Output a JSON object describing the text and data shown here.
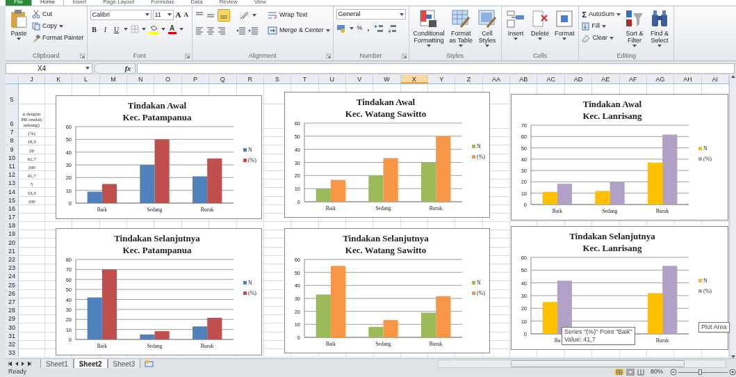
{
  "ribbon": {
    "tabs": [
      {
        "label": "File",
        "selected": false
      },
      {
        "label": "Home",
        "selected": true
      },
      {
        "label": "Insert",
        "selected": false
      },
      {
        "label": "Page Layout",
        "selected": false
      },
      {
        "label": "Formulas",
        "selected": false
      },
      {
        "label": "Data",
        "selected": false
      },
      {
        "label": "Review",
        "selected": false
      },
      {
        "label": "View",
        "selected": false
      }
    ],
    "clipboard": {
      "label": "Clipboard",
      "paste": "Paste",
      "cut": "Cut",
      "copy": "Copy",
      "format_painter": "Format Painter"
    },
    "font": {
      "label": "Font",
      "font_name": "Calibri",
      "font_size": "11",
      "grow": "A",
      "shrink": "A",
      "bold": "B",
      "italic": "I",
      "underline": "U",
      "font_color": "A"
    },
    "alignment": {
      "label": "Alignment",
      "bottom_align_selected": true,
      "wrap_text": "Wrap Text",
      "merge_center": "Merge & Center"
    },
    "number": {
      "label": "Number",
      "format": "General",
      "percent": "%",
      "comma": ","
    },
    "styles": {
      "label": "Styles",
      "buttons": [
        "Conditional\nFormatting",
        "Format\nas Table",
        "Cell\nStyles"
      ]
    },
    "cells": {
      "label": "Cells",
      "buttons": [
        "Insert",
        "Delete",
        "Format"
      ]
    },
    "editing": {
      "label": "Editing",
      "sigma": "Σ",
      "autosum": "AutoSum",
      "fill": "Fill",
      "clear": "Clear",
      "sort_filter": "Sort &\nFilter",
      "find_select": "Find &\nSelect"
    }
  },
  "formula_bar": {
    "name_box": "X4",
    "function_label": "fx"
  },
  "columns": [
    {
      "label": "J",
      "selected": false
    },
    {
      "label": "K",
      "selected": false
    },
    {
      "label": "L",
      "selected": false
    },
    {
      "label": "M",
      "selected": false
    },
    {
      "label": "N",
      "selected": false
    },
    {
      "label": "O",
      "selected": false
    },
    {
      "label": "P",
      "selected": false
    },
    {
      "label": "Q",
      "selected": false
    },
    {
      "label": "R",
      "selected": false
    },
    {
      "label": "S",
      "selected": false
    },
    {
      "label": "T",
      "selected": false
    },
    {
      "label": "U",
      "selected": false
    },
    {
      "label": "V",
      "selected": false
    },
    {
      "label": "W",
      "selected": false
    },
    {
      "label": "X",
      "selected": true
    },
    {
      "label": "Y",
      "selected": false
    },
    {
      "label": "Z",
      "selected": false
    },
    {
      "label": "AA",
      "selected": false
    },
    {
      "label": "AB",
      "selected": false
    },
    {
      "label": "AC",
      "selected": false
    },
    {
      "label": "AD",
      "selected": false
    },
    {
      "label": "AE",
      "selected": false
    },
    {
      "label": "AF",
      "selected": false
    },
    {
      "label": "AG",
      "selected": false
    },
    {
      "label": "AH",
      "selected": false
    },
    {
      "label": "AI",
      "selected": false
    }
  ],
  "rows": [
    {
      "label": "5"
    },
    {
      "label": "6",
      "j": "n dengan\nPR rendah\nnrisang)"
    },
    {
      "label": "7",
      "j": "(%)"
    },
    {
      "label": "8",
      "j": "18,3"
    },
    {
      "label": "9",
      "j": "20"
    },
    {
      "label": "10",
      "j": "61,7"
    },
    {
      "label": "11",
      "j": "100"
    },
    {
      "label": "12",
      "j": "41,7"
    },
    {
      "label": "13",
      "j": "5"
    },
    {
      "label": "14",
      "j": "53,3"
    },
    {
      "label": "15",
      "j": "100"
    },
    {
      "label": "16"
    },
    {
      "label": "17"
    },
    {
      "label": "18"
    },
    {
      "label": "19"
    },
    {
      "label": "20"
    },
    {
      "label": "21"
    },
    {
      "label": "22"
    },
    {
      "label": "23"
    },
    {
      "label": "24"
    },
    {
      "label": "25"
    },
    {
      "label": "26"
    },
    {
      "label": "27"
    },
    {
      "label": "28"
    },
    {
      "label": "29"
    },
    {
      "label": "30"
    },
    {
      "label": "31"
    },
    {
      "label": "32"
    },
    {
      "label": "33"
    }
  ],
  "charts": [
    {
      "chart_data": {
        "type": "bar",
        "title": "Tindakan Awal\nKec. Patampanua",
        "categories": [
          "Baik",
          "Sedang",
          "Buruk"
        ],
        "series": [
          {
            "name": "N",
            "color": "#4f81bd",
            "values": [
              9,
              30,
              21
            ]
          },
          {
            "name": "(%)",
            "color": "#c0504d",
            "values": [
              15,
              50,
              35
            ]
          }
        ],
        "grid": true,
        "legend": "right",
        "ylim": [
          0,
          60
        ],
        "yticks": [
          0,
          10,
          20,
          30,
          40,
          50,
          60
        ]
      }
    },
    {
      "chart_data": {
        "type": "bar",
        "title": "Tindakan Awal\nKec. Watang Sawitto",
        "categories": [
          "Baik",
          "Sedang",
          "Buruk"
        ],
        "series": [
          {
            "name": "N",
            "color": "#9bbb59",
            "values": [
              10,
              20,
              30
            ]
          },
          {
            "name": "(%)",
            "color": "#f79646",
            "values": [
              16.7,
              33.3,
              50
            ]
          }
        ],
        "grid": true,
        "legend": "right",
        "ylim": [
          0,
          60
        ],
        "yticks": [
          0,
          10,
          20,
          30,
          40,
          50,
          60
        ]
      }
    },
    {
      "chart_data": {
        "type": "bar",
        "title": "Tindakan Awal\nKec. Lanrisang",
        "categories": [
          "Baik",
          "Sedang",
          "Buruk"
        ],
        "series": [
          {
            "name": "N",
            "color": "#ffc000",
            "values": [
              11,
              12,
              37
            ]
          },
          {
            "name": "(%)",
            "color": "#b2a1c7",
            "values": [
              18.3,
              20,
              61.7
            ]
          }
        ],
        "grid": true,
        "legend": "right",
        "ylim": [
          0,
          70
        ],
        "yticks": [
          0,
          10,
          20,
          30,
          40,
          50,
          60,
          70
        ]
      }
    },
    {
      "chart_data": {
        "type": "bar",
        "title": "Tindakan Selanjutnya\nKec. Patampanua",
        "categories": [
          "Baik",
          "Sedang",
          "Buruk"
        ],
        "series": [
          {
            "name": "N",
            "color": "#4f81bd",
            "values": [
              42,
              5,
              13
            ]
          },
          {
            "name": "(%)",
            "color": "#c0504d",
            "values": [
              70,
              8.3,
              21.7
            ]
          }
        ],
        "grid": true,
        "legend": "right",
        "ylim": [
          0,
          80
        ],
        "yticks": [
          0,
          10,
          20,
          30,
          40,
          50,
          60,
          70,
          80
        ]
      }
    },
    {
      "chart_data": {
        "type": "bar",
        "title": "Tindakan Selanjutnya\nKec. Watang Sawitto",
        "categories": [
          "Baik",
          "Sedang",
          "Buruk"
        ],
        "series": [
          {
            "name": "N",
            "color": "#9bbb59",
            "values": [
              33,
              8,
              19
            ]
          },
          {
            "name": "(%)",
            "color": "#f79646",
            "values": [
              55,
              13.3,
              31.7
            ]
          }
        ],
        "grid": true,
        "legend": "right",
        "ylim": [
          0,
          60
        ],
        "yticks": [
          0,
          10,
          20,
          30,
          40,
          50,
          60
        ]
      }
    },
    {
      "chart_data": {
        "type": "bar",
        "title": "Tindakan Selanjutnya\nKec. Lanrisang",
        "categories": [
          "Ba",
          null,
          "Buruk"
        ],
        "series": [
          {
            "name": "N",
            "color": "#ffc000",
            "values": [
              25,
              null,
              32
            ]
          },
          {
            "name": "(%)",
            "color": "#b2a1c7",
            "values": [
              41.7,
              null,
              53.3
            ]
          }
        ],
        "grid": true,
        "legend": "right",
        "ylim": [
          0,
          60
        ],
        "yticks": [
          0,
          10,
          20,
          30,
          40,
          50,
          60
        ]
      }
    }
  ],
  "chart_tooltip": {
    "lines": [
      "Series \"(%)\" Point \"Baik\"",
      "Value: 41,7"
    ]
  },
  "plot_area_tooltip": "Plot Area",
  "sheet_tabs": [
    {
      "label": "Sheet1",
      "selected": false
    },
    {
      "label": "Sheet2",
      "selected": true
    },
    {
      "label": "Sheet3",
      "selected": false
    }
  ],
  "status_bar": {
    "status": "Ready",
    "zoom": "80%",
    "zoom_slider": {
      "level": 0.45
    }
  }
}
